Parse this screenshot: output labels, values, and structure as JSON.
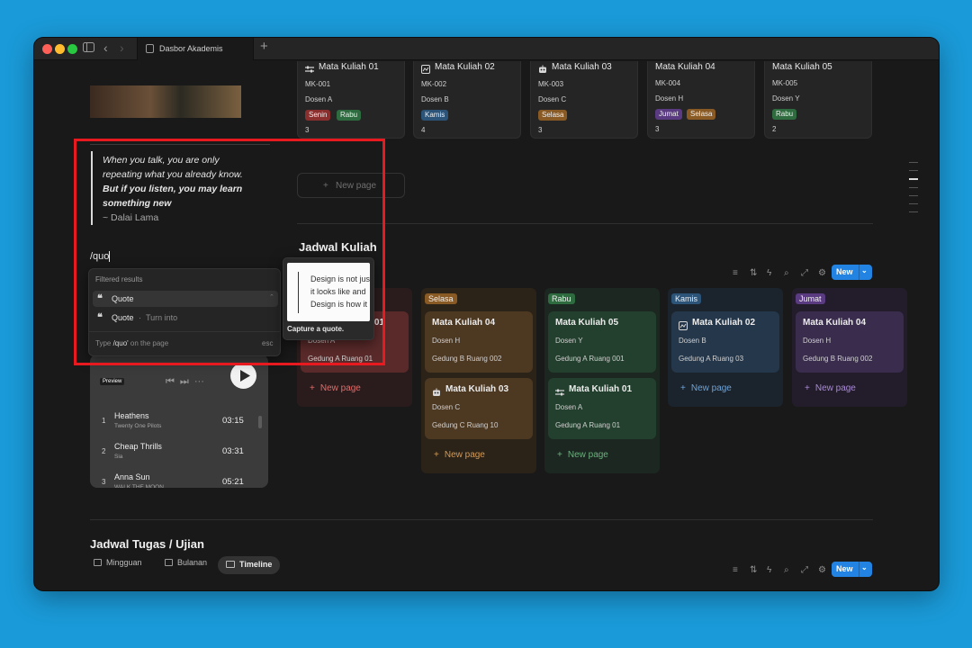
{
  "colors": {
    "background": "#1a9ad8",
    "window": "#191919",
    "accent": "#2383e2",
    "highlight_box": "#e8191f"
  },
  "browser": {
    "tab_title": "Dasbor Akademis",
    "new_tab": "+"
  },
  "top_cards": [
    {
      "title": "Mata Kuliah 01",
      "icon": "sliders-icon",
      "code": "MK-001",
      "lecturer": "Dosen A",
      "tags": [
        {
          "label": "Senin",
          "color": "#8b2e2e"
        },
        {
          "label": "Rabu",
          "color": "#2e6b3e"
        }
      ],
      "count": "3"
    },
    {
      "title": "Mata Kuliah 02",
      "icon": "chart-icon",
      "code": "MK-002",
      "lecturer": "Dosen B",
      "tags": [
        {
          "label": "Kamis",
          "color": "#2b5478"
        }
      ],
      "count": "4"
    },
    {
      "title": "Mata Kuliah 03",
      "icon": "robot-icon",
      "code": "MK-003",
      "lecturer": "Dosen C",
      "tags": [
        {
          "label": "Selasa",
          "color": "#8a5a24"
        }
      ],
      "count": "3"
    },
    {
      "title": "Mata Kuliah 04",
      "icon": "",
      "code": "MK-004",
      "lecturer": "Dosen H",
      "tags": [
        {
          "label": "Jumat",
          "color": "#5a3a80"
        },
        {
          "label": "Selasa",
          "color": "#8a5a24"
        }
      ],
      "count": "3"
    },
    {
      "title": "Mata Kuliah 05",
      "icon": "",
      "code": "MK-005",
      "lecturer": "Dosen Y",
      "tags": [
        {
          "label": "Rabu",
          "color": "#2e6b3e"
        }
      ],
      "count": "2"
    }
  ],
  "new_page_label": "New page",
  "quote": {
    "line1": "When you talk, you are only",
    "line2": "repeating what you already know.",
    "line3": "But if you listen, you may learn",
    "line4": "something new",
    "author": "~ Dalai Lama"
  },
  "slash_input": "/quo",
  "menu": {
    "header": "Filtered results",
    "item1": "Quote",
    "item2": "Quote",
    "item2_hint": "Turn into",
    "footer_prefix": "Type",
    "footer_query": "/quo'",
    "footer_suffix": "on the page",
    "footer_esc": "esc"
  },
  "preview": {
    "line1": "Design is not jus",
    "line2": "it looks like and",
    "line3": "Design is how it",
    "caption": "Capture a quote."
  },
  "schedule": {
    "title": "Jadwal Kuliah",
    "new_button": "New",
    "columns": [
      {
        "label": "Senin",
        "tag_color": "#8b2e2e",
        "bg": "#2a1c1c",
        "card_bg": "#5a2a2a",
        "np_color": "#e06b6b",
        "cards": [
          {
            "title": "Mata Kuliah 01",
            "icon": "sliders-icon",
            "lecturer": "Dosen A",
            "room": "Gedung A Ruang 01"
          }
        ]
      },
      {
        "label": "Selasa",
        "tag_color": "#8a5a24",
        "bg": "#2b2218",
        "card_bg": "#4d3822",
        "np_color": "#d39a55",
        "cards": [
          {
            "title": "Mata Kuliah 04",
            "icon": "",
            "lecturer": "Dosen H",
            "room": "Gedung B Ruang 002"
          },
          {
            "title": "Mata Kuliah 03",
            "icon": "robot-icon",
            "lecturer": "Dosen C",
            "room": "Gedung C Ruang 10"
          }
        ]
      },
      {
        "label": "Rabu",
        "tag_color": "#2e6b3e",
        "bg": "#1b2720",
        "card_bg": "#22402d",
        "np_color": "#6cb07f",
        "cards": [
          {
            "title": "Mata Kuliah 05",
            "icon": "",
            "lecturer": "Dosen Y",
            "room": "Gedung A Ruang 001"
          },
          {
            "title": "Mata Kuliah 01",
            "icon": "sliders-icon",
            "lecturer": "Dosen A",
            "room": "Gedung A Ruang 01"
          }
        ]
      },
      {
        "label": "Kamis",
        "tag_color": "#2b5478",
        "bg": "#1b232c",
        "card_bg": "#25374a",
        "np_color": "#6fa3d6",
        "cards": [
          {
            "title": "Mata Kuliah 02",
            "icon": "chart-icon",
            "lecturer": "Dosen B",
            "room": "Gedung A Ruang 03"
          }
        ]
      },
      {
        "label": "Jumat",
        "tag_color": "#5a3a80",
        "bg": "#231d2b",
        "card_bg": "#392c4d",
        "np_color": "#a98ad6",
        "cards": [
          {
            "title": "Mata Kuliah 04",
            "icon": "",
            "lecturer": "Dosen H",
            "room": "Gedung B Ruang 002"
          }
        ]
      }
    ]
  },
  "music": {
    "preview_badge": "Preview",
    "tracks": [
      {
        "num": "1",
        "title": "Heathens",
        "artist": "Twenty One Pilots",
        "time": "03:15"
      },
      {
        "num": "2",
        "title": "Cheap Thrills",
        "artist": "Sia",
        "time": "03:31"
      },
      {
        "num": "3",
        "title": "Anna Sun",
        "artist": "WALK THE MOON",
        "time": "05:21"
      }
    ]
  },
  "tasks": {
    "title": "Jadwal Tugas / Ujian",
    "views": [
      "Mingguan",
      "Bulanan",
      "Timeline"
    ],
    "new_button": "New"
  }
}
